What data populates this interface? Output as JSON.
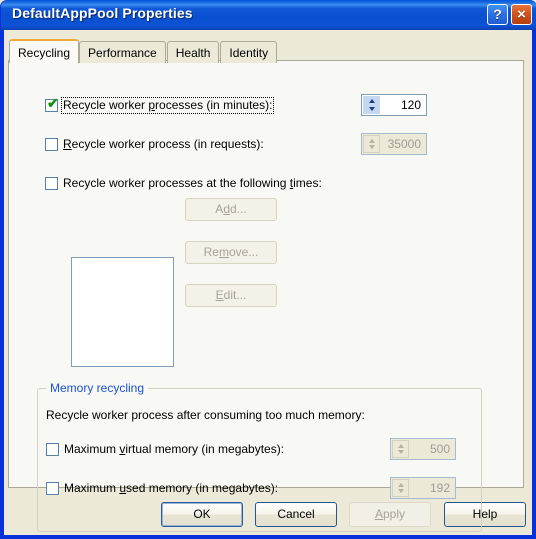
{
  "window": {
    "title": "DefaultAppPool Properties",
    "help_button": "?",
    "close_button": "×"
  },
  "tabs": [
    {
      "label": "Recycling",
      "selected": true
    },
    {
      "label": "Performance",
      "selected": false
    },
    {
      "label": "Health",
      "selected": false
    },
    {
      "label": "Identity",
      "selected": false
    }
  ],
  "recycling": {
    "minutes": {
      "label_before": "Recycle worker ",
      "label_accel": "p",
      "label_after": "rocesses (in minutes):",
      "checked": true,
      "value": "120",
      "enabled": true
    },
    "requests": {
      "label_before": "",
      "label_accel": "R",
      "label_after": "ecycle worker process (in requests):",
      "checked": false,
      "value": "35000",
      "enabled": false
    },
    "times": {
      "label_before": "Recycle worker processes at the following ",
      "label_accel": "t",
      "label_after": "imes:",
      "checked": false,
      "items": []
    },
    "buttons": [
      {
        "before": "A",
        "accel": "d",
        "after": "d...",
        "enabled": false
      },
      {
        "before": "Re",
        "accel": "m",
        "after": "ove...",
        "enabled": false
      },
      {
        "before": "",
        "accel": "E",
        "after": "dit...",
        "enabled": false
      }
    ]
  },
  "memory_group": {
    "legend": "Memory recycling",
    "description": "Recycle worker process after consuming too much memory:",
    "virtual": {
      "label_before": "Maximum ",
      "label_accel": "v",
      "label_after": "irtual memory (in megabytes):",
      "checked": false,
      "value": "500",
      "enabled": false
    },
    "used": {
      "label_before": "Maximum ",
      "label_accel": "u",
      "label_after": "sed memory (in megabytes):",
      "checked": false,
      "value": "192",
      "enabled": false
    }
  },
  "footer": {
    "ok": "OK",
    "cancel": "Cancel",
    "apply_before": "",
    "apply_accel": "A",
    "apply_after": "pply",
    "help": "Help"
  },
  "colors": {
    "titlebar_blue": "#0a50d2",
    "frame_blue": "#0831d9",
    "tab_accent_orange": "#f1a83b",
    "group_legend_blue": "#1b52d4",
    "check_green": "#188f18",
    "dialog_face": "#ece9d8",
    "tabpage_face": "#f8f8f5",
    "disabled_text": "#9d9d94"
  }
}
